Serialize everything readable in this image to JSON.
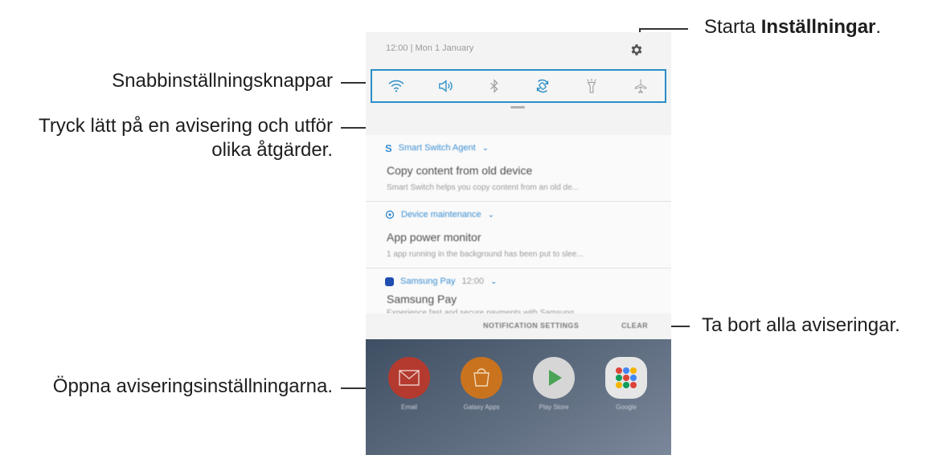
{
  "callouts": {
    "settings_prefix": "Starta ",
    "settings_bold": "Inställningar",
    "settings_suffix": ".",
    "quick_settings": "Snabbinställningsknappar",
    "tap_notification_line1": "Tryck lätt på en avisering och utför",
    "tap_notification_line2": "olika åtgärder.",
    "clear_all": "Ta bort alla aviseringar.",
    "open_notification_settings": "Öppna aviseringsinställningarna."
  },
  "phone": {
    "status": {
      "datetime": "12:00 | Mon 1 January",
      "settings_icon": "gear-icon"
    },
    "quick_settings": [
      {
        "icon": "wifi-icon",
        "active": true
      },
      {
        "icon": "sound-icon",
        "active": true
      },
      {
        "icon": "bluetooth-icon",
        "active": false
      },
      {
        "icon": "auto-rotate-icon",
        "active": true
      },
      {
        "icon": "flashlight-icon",
        "active": false
      },
      {
        "icon": "airplane-mode-icon",
        "active": false
      }
    ],
    "notifications": [
      {
        "app": "Smart Switch Agent",
        "icon": "smart-switch-icon",
        "title": "Copy content from old device",
        "body": "Smart Switch helps you copy content from an old de..."
      },
      {
        "app": "Device maintenance",
        "icon": "device-maintenance-icon",
        "title": "App power monitor",
        "body": "1 app running in the background has been put to slee..."
      },
      {
        "app": "Samsung Pay",
        "time": "12:00",
        "icon": "samsung-pay-icon",
        "title": "Samsung Pay",
        "body": "Experience fast and secure payments with Samsung..."
      }
    ],
    "actions": {
      "notification_settings": "NOTIFICATION SETTINGS",
      "clear": "CLEAR"
    },
    "home_apps": [
      {
        "label": "Email",
        "color": "#c0392b"
      },
      {
        "label": "Galaxy Apps",
        "color": "#d77a1f"
      },
      {
        "label": "Play Store",
        "color": "#dcdcdc"
      },
      {
        "label": "Google",
        "color": "#e5e5e5"
      }
    ],
    "accent_color": "#2a8ec8"
  }
}
